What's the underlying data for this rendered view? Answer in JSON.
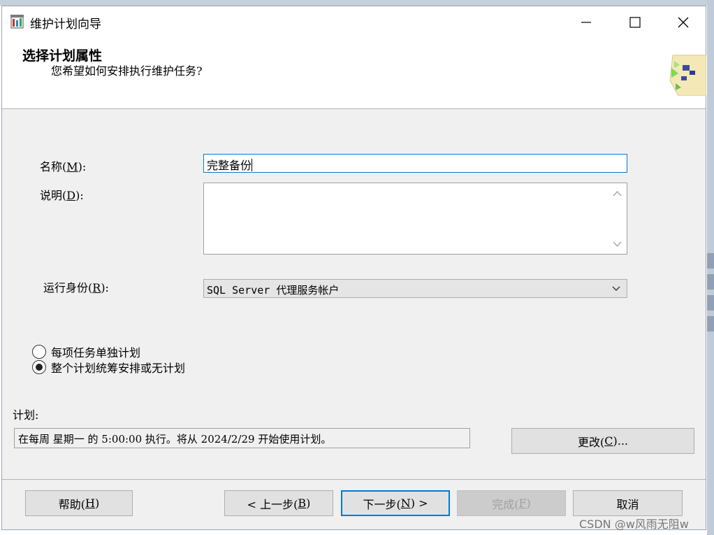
{
  "window": {
    "title": "维护计划向导"
  },
  "header": {
    "title": "选择计划属性",
    "subtitle": "您希望如何安排执行维护任务?"
  },
  "form": {
    "name": {
      "label": "名称",
      "mnemonic": "M",
      "label_suffix": "):",
      "value": "完整备份"
    },
    "description": {
      "label": "说明",
      "mnemonic": "D",
      "label_suffix": "):",
      "value": ""
    },
    "run_as": {
      "label": "运行身份",
      "mnemonic": "R",
      "label_suffix": "):",
      "selected": "SQL Server 代理服务帐户"
    }
  },
  "radios": [
    {
      "label": "每项任务单独计划",
      "checked": false
    },
    {
      "label": "整个计划统筹安排或无计划",
      "checked": true
    }
  ],
  "schedule": {
    "label": "计划:",
    "text": "在每周 星期一 的 5:00:00 执行。将从 2024/2/29 开始使用计划。",
    "change_button": {
      "prefix": "更改(",
      "mnemonic": "C",
      "suffix": ")..."
    }
  },
  "buttons": {
    "help": {
      "prefix": "帮助(",
      "mnemonic": "H",
      "suffix": ")"
    },
    "back": {
      "prefix": "< 上一步(",
      "mnemonic": "B",
      "suffix": ")"
    },
    "next": {
      "prefix": "下一步(",
      "mnemonic": "N",
      "suffix": ") >"
    },
    "finish": {
      "prefix": "完成(",
      "mnemonic": "F",
      "suffix": ")"
    },
    "cancel": {
      "label": "取消"
    }
  },
  "watermark": "CSDN @w风雨无阻w"
}
